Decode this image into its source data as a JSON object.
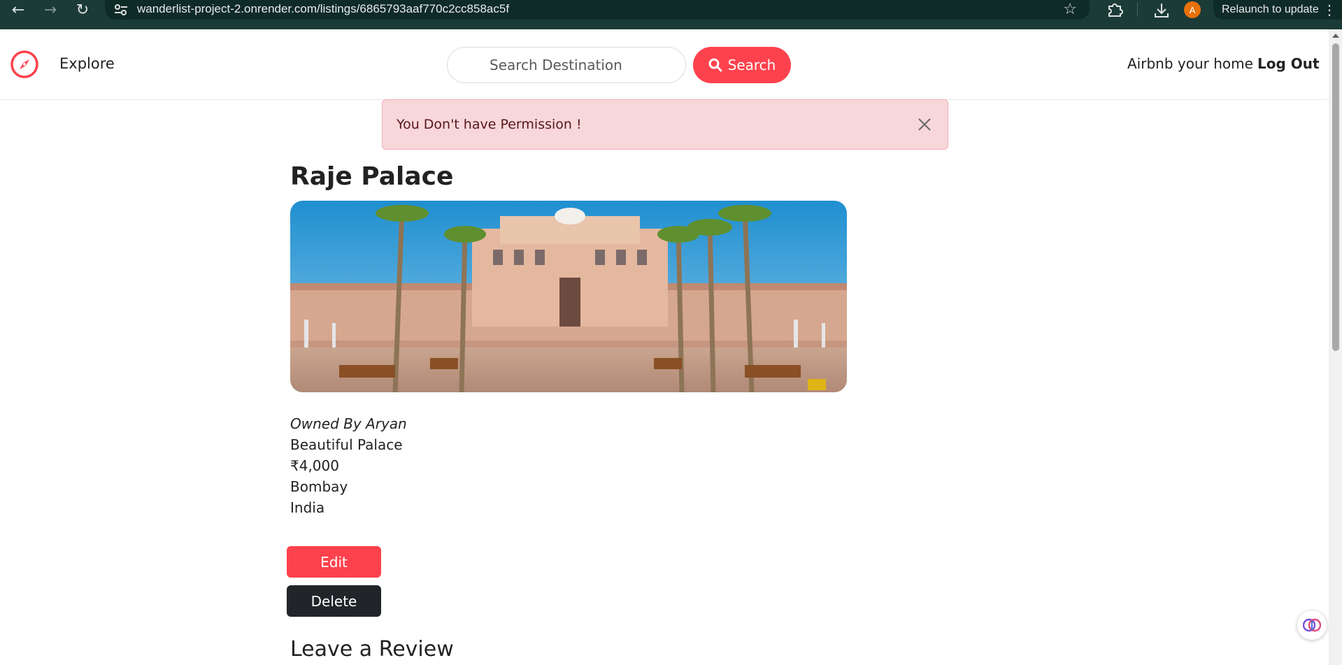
{
  "browser": {
    "url": "wanderlist-project-2.onrender.com/listings/6865793aaf770c2cc858ac5f",
    "avatar_letter": "A",
    "relaunch_label": "Relaunch to update"
  },
  "navbar": {
    "explore_label": "Explore",
    "search_placeholder": "Search Destination",
    "search_button_label": "Search",
    "host_label": "Airbnb your home",
    "logout_label": "Log Out",
    "accent_color": "#fe424d"
  },
  "flash": {
    "message": "You Don't have Permission !",
    "bg_color": "#f8d7da"
  },
  "listing": {
    "title": "Raje Palace",
    "owner": "Owned By Aryan",
    "description": "Beautiful Palace",
    "price": "₹4,000",
    "location": "Bombay",
    "country": "India",
    "edit_label": "Edit",
    "delete_label": "Delete"
  },
  "reviews": {
    "heading": "Leave a Review"
  }
}
